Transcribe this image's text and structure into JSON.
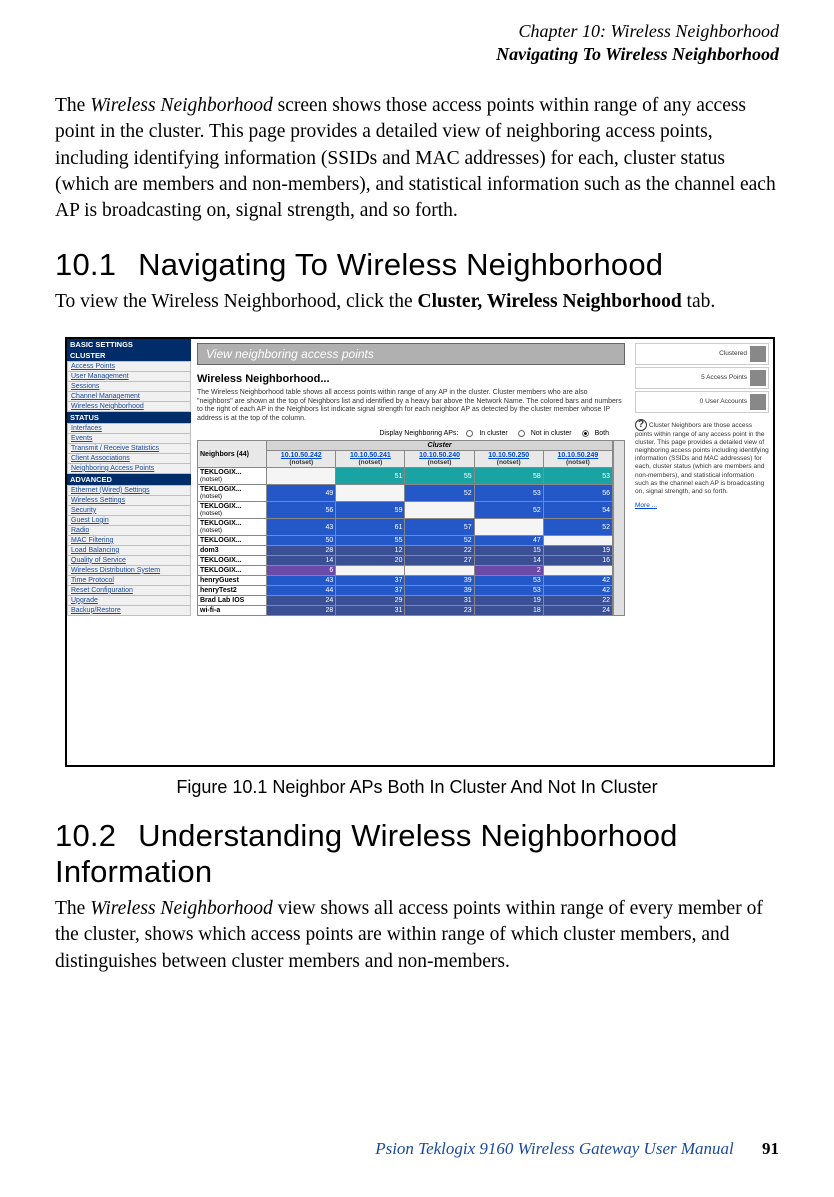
{
  "header": {
    "chapter": "Chapter 10:  Wireless Neighborhood",
    "section": "Navigating To Wireless Neighborhood"
  },
  "intro_para": "The Wireless Neighborhood screen shows those access points within range of any access point in the cluster. This page provides a detailed view of neighboring access points, including identifying information (SSIDs and MAC addresses) for each, cluster status (which are members and non-members), and statistical information such as the channel each AP is broadcasting on, signal strength, and so forth.",
  "s101": {
    "num": "10.1",
    "title": "Navigating To Wireless Neighborhood",
    "para_a": "To view the Wireless Neighborhood, click the ",
    "para_b": "Cluster, Wireless Neighborhood",
    "para_c": " tab."
  },
  "figure": {
    "caption": "Figure 10.1 Neighbor APs Both In Cluster And Not In Cluster"
  },
  "s102": {
    "num": "10.2",
    "title": "Understanding Wireless Neighborhood Information",
    "para": "The Wireless Neighborhood view shows all access points within range of every member of the cluster, shows which access points are within range of which cluster members, and distinguishes between cluster members and non-members."
  },
  "footer": {
    "book": "Psion Teklogix 9160 Wireless Gateway User Manual",
    "page": "91"
  },
  "shot": {
    "sidebar_groups": [
      {
        "header": "BASIC SETTINGS",
        "items": []
      },
      {
        "header": "CLUSTER",
        "items": [
          "Access Points",
          "User Management",
          "Sessions",
          "Channel Management",
          "Wireless Neighborhood"
        ]
      },
      {
        "header": "STATUS",
        "items": [
          "Interfaces",
          "Events",
          "Transmit / Receive Statistics",
          "Client Associations",
          "Neighboring Access Points"
        ]
      },
      {
        "header": "ADVANCED",
        "items": [
          "Ethernet (Wired) Settings",
          "Wireless Settings",
          "Security",
          "Guest Login",
          "Radio",
          "MAC Filtering",
          "Load Balancing",
          "Quality of Service",
          "Wireless Distribution System",
          "Time Protocol",
          "Reset Configuration",
          "Upgrade",
          "Backup/Restore"
        ]
      }
    ],
    "banner": "View neighboring access points",
    "main_title": "Wireless Neighborhood...",
    "main_blurb": "The Wireless Neighborhood table shows all access points within range of any AP in the cluster.  Cluster members who are also \"neighbors\" are shown at the top of Neighbors list and identified by a heavy bar above the Network Name.  The colored bars and numbers to the right of each AP in the Neighbors list indicate signal strength for each neighbor AP as detected by the cluster member whose IP address is at the top of the column.",
    "filter": {
      "label": "Display Neighboring APs:",
      "opts": [
        "In cluster",
        "Not in cluster",
        "Both"
      ],
      "selected": 2
    },
    "cluster_label": "Cluster",
    "neighbors_label": "Neighbors (44)",
    "ips": [
      "10.10.50.242",
      "10.10.50.241",
      "10.10.50.240",
      "10.10.50.250",
      "10.10.50.249"
    ],
    "notset": "(notset)",
    "rows": [
      {
        "name": "TEKLOGIX...",
        "sub": "(notset)",
        "v": [
          "",
          "51",
          "55",
          "58",
          "53"
        ],
        "cls": [
          "c-empty",
          "c-teal",
          "c-teal",
          "c-teal",
          "c-teal"
        ]
      },
      {
        "name": "TEKLOGIX...",
        "sub": "(notset)",
        "v": [
          "49",
          "",
          "52",
          "53",
          "56"
        ],
        "cls": [
          "c-blue",
          "c-empty",
          "c-blue",
          "c-blue",
          "c-blue"
        ]
      },
      {
        "name": "TEKLOGIX...",
        "sub": "(notset)",
        "v": [
          "56",
          "59",
          "",
          "52",
          "54"
        ],
        "cls": [
          "c-blue",
          "c-blue",
          "c-empty",
          "c-blue",
          "c-blue"
        ]
      },
      {
        "name": "TEKLOGIX...",
        "sub": "(notset)",
        "v": [
          "43",
          "61",
          "57",
          "",
          "52"
        ],
        "cls": [
          "c-blue",
          "c-blue",
          "c-blue",
          "c-empty",
          "c-blue"
        ]
      },
      {
        "name": "TEKLOGIX...",
        "sub": "",
        "v": [
          "50",
          "55",
          "52",
          "47",
          ""
        ],
        "cls": [
          "c-blue",
          "c-blue",
          "c-blue",
          "c-blue",
          "c-empty"
        ]
      },
      {
        "name": "dom3",
        "sub": "",
        "v": [
          "28",
          "12",
          "22",
          "15",
          "19"
        ],
        "cls": [
          "c-dblue",
          "c-dblue",
          "c-dblue",
          "c-dblue",
          "c-dblue"
        ]
      },
      {
        "name": "TEKLOGIX...",
        "sub": "",
        "v": [
          "14",
          "20",
          "27",
          "14",
          "16"
        ],
        "cls": [
          "c-dblue",
          "c-dblue",
          "c-dblue",
          "c-dblue",
          "c-dblue"
        ]
      },
      {
        "name": "TEKLOGIX...",
        "sub": "",
        "v": [
          "6",
          "",
          "",
          "2",
          ""
        ],
        "cls": [
          "c-purple",
          "c-empty",
          "c-empty",
          "c-purple",
          "c-empty"
        ]
      },
      {
        "name": "henryGuest",
        "sub": "",
        "v": [
          "43",
          "37",
          "39",
          "53",
          "42"
        ],
        "cls": [
          "c-blue",
          "c-blue",
          "c-blue",
          "c-blue",
          "c-blue"
        ]
      },
      {
        "name": "henryTest2",
        "sub": "",
        "v": [
          "44",
          "37",
          "39",
          "53",
          "42"
        ],
        "cls": [
          "c-blue",
          "c-blue",
          "c-blue",
          "c-blue",
          "c-blue"
        ]
      },
      {
        "name": "Brad Lab IOS",
        "sub": "",
        "v": [
          "24",
          "29",
          "31",
          "19",
          "22"
        ],
        "cls": [
          "c-dblue",
          "c-dblue",
          "c-dblue",
          "c-dblue",
          "c-dblue"
        ]
      },
      {
        "name": "wi-fi-a",
        "sub": "",
        "v": [
          "28",
          "31",
          "23",
          "18",
          "24"
        ],
        "cls": [
          "c-dblue",
          "c-dblue",
          "c-dblue",
          "c-dblue",
          "c-dblue"
        ]
      }
    ],
    "right": {
      "stats": [
        {
          "label": "Clustered"
        },
        {
          "label": "5\nAccess\nPoints"
        },
        {
          "label": "0 User\nAccounts"
        }
      ],
      "help_title": "Cluster Neighbors are those access points within range of any access point in the cluster. This page provides a detailed view of neighboring access points including identifying information (SSIDs and MAC addresses) for each, cluster status (which are members and non-members), and statistical information such as the channel each AP is broadcasting on, signal strength, and so forth.",
      "more": "More ..."
    }
  }
}
